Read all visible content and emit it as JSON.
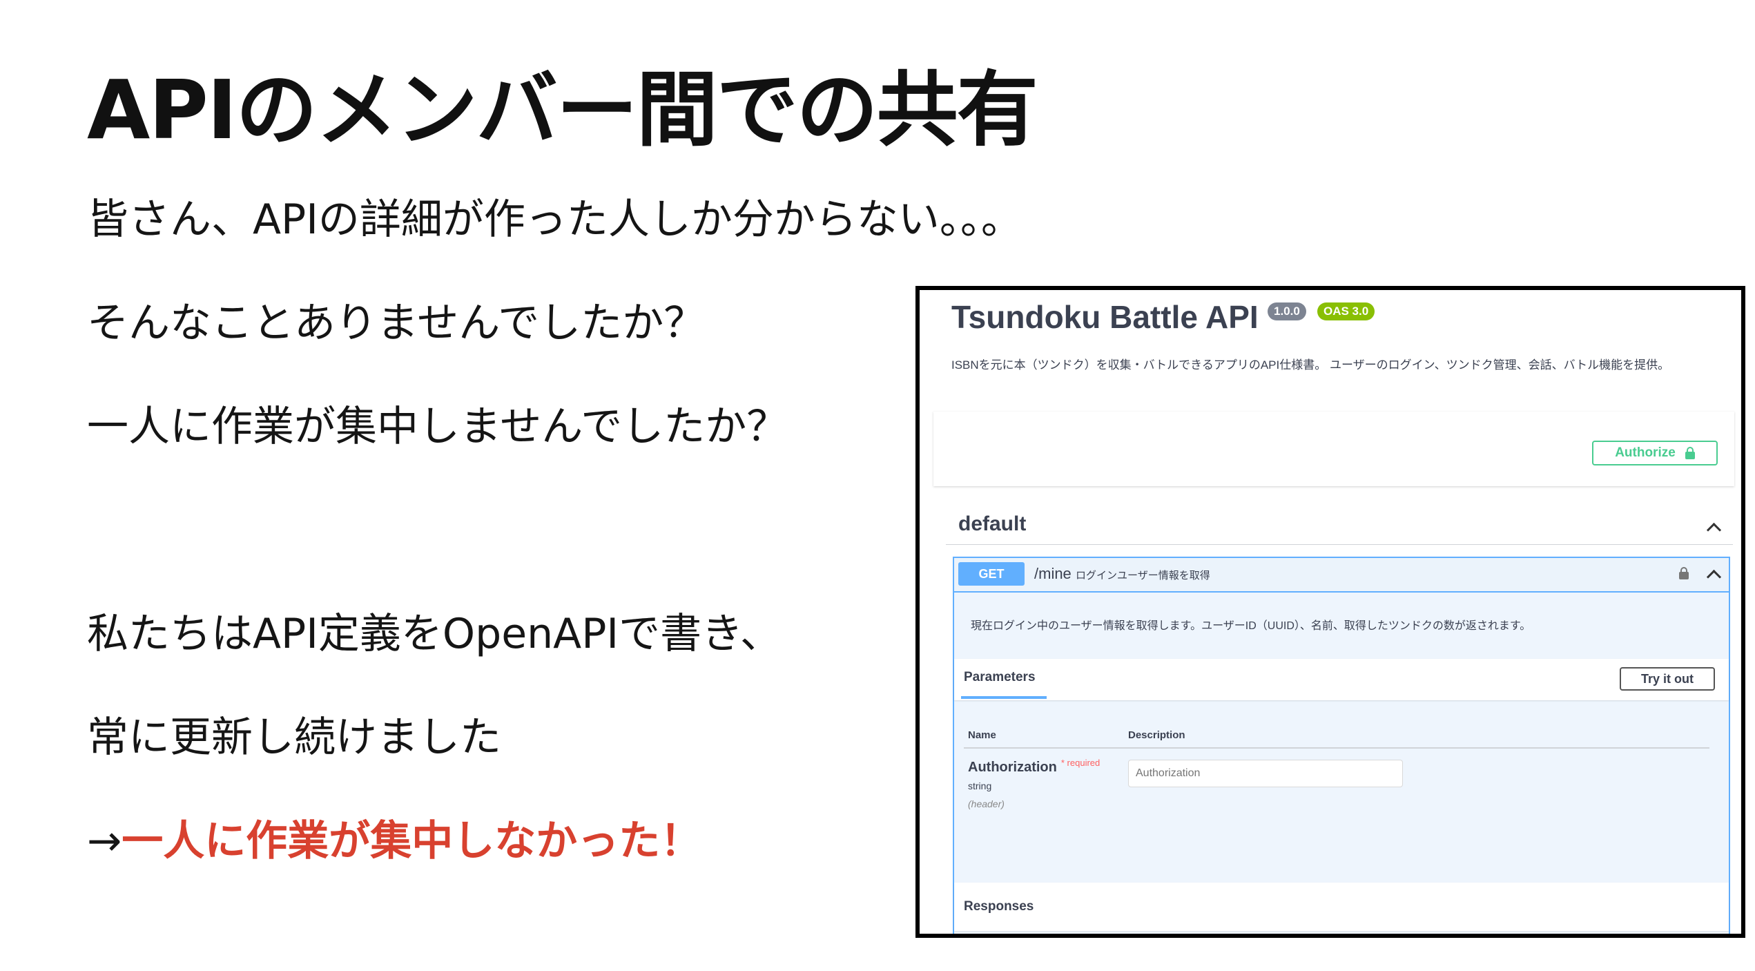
{
  "slide": {
    "title": "APIのメンバー間での共有",
    "lines": [
      "皆さん、APIの詳細が作った人しか分からない。。。",
      "そんなことありませんでしたか？",
      "一人に作業が集中しませんでしたか？",
      "私たちはAPI定義をOpenAPIで書き、",
      "常に更新し続けました"
    ],
    "conclusion_arrow": "→",
    "conclusion_highlight": "一人に作業が集中しなかった！"
  },
  "swagger": {
    "title": "Tsundoku Battle API",
    "version_badge": "1.0.0",
    "oas_badge": "OAS 3.0",
    "description": "ISBNを元に本（ツンドク）を収集・バトルできるアプリのAPI仕様書。 ユーザーのログイン、ツンドク管理、会話、バトル機能を提供。",
    "authorize_label": "Authorize",
    "tag_name": "default",
    "operation": {
      "method": "GET",
      "path": "/mine",
      "summary": "ログインユーザー情報を取得",
      "description": "現在ログイン中のユーザー情報を取得します。ユーザーID（UUID）、名前、取得したツンドクの数が返されます。",
      "parameters_tab": "Parameters",
      "try_it_out_label": "Try it out",
      "columns": [
        "Name",
        "Description"
      ],
      "parameter": {
        "name": "Authorization",
        "required_label": "* required",
        "type": "string",
        "location": "(header)",
        "placeholder": "Authorization"
      },
      "responses_label": "Responses"
    }
  },
  "colors": {
    "highlight": "#d8412f",
    "get_method": "#61affe",
    "authorize": "#49cc90",
    "oas_badge": "#89bf04",
    "version_badge": "#7d8492"
  },
  "icons": [
    "lock-icon",
    "chevron-up-icon"
  ]
}
